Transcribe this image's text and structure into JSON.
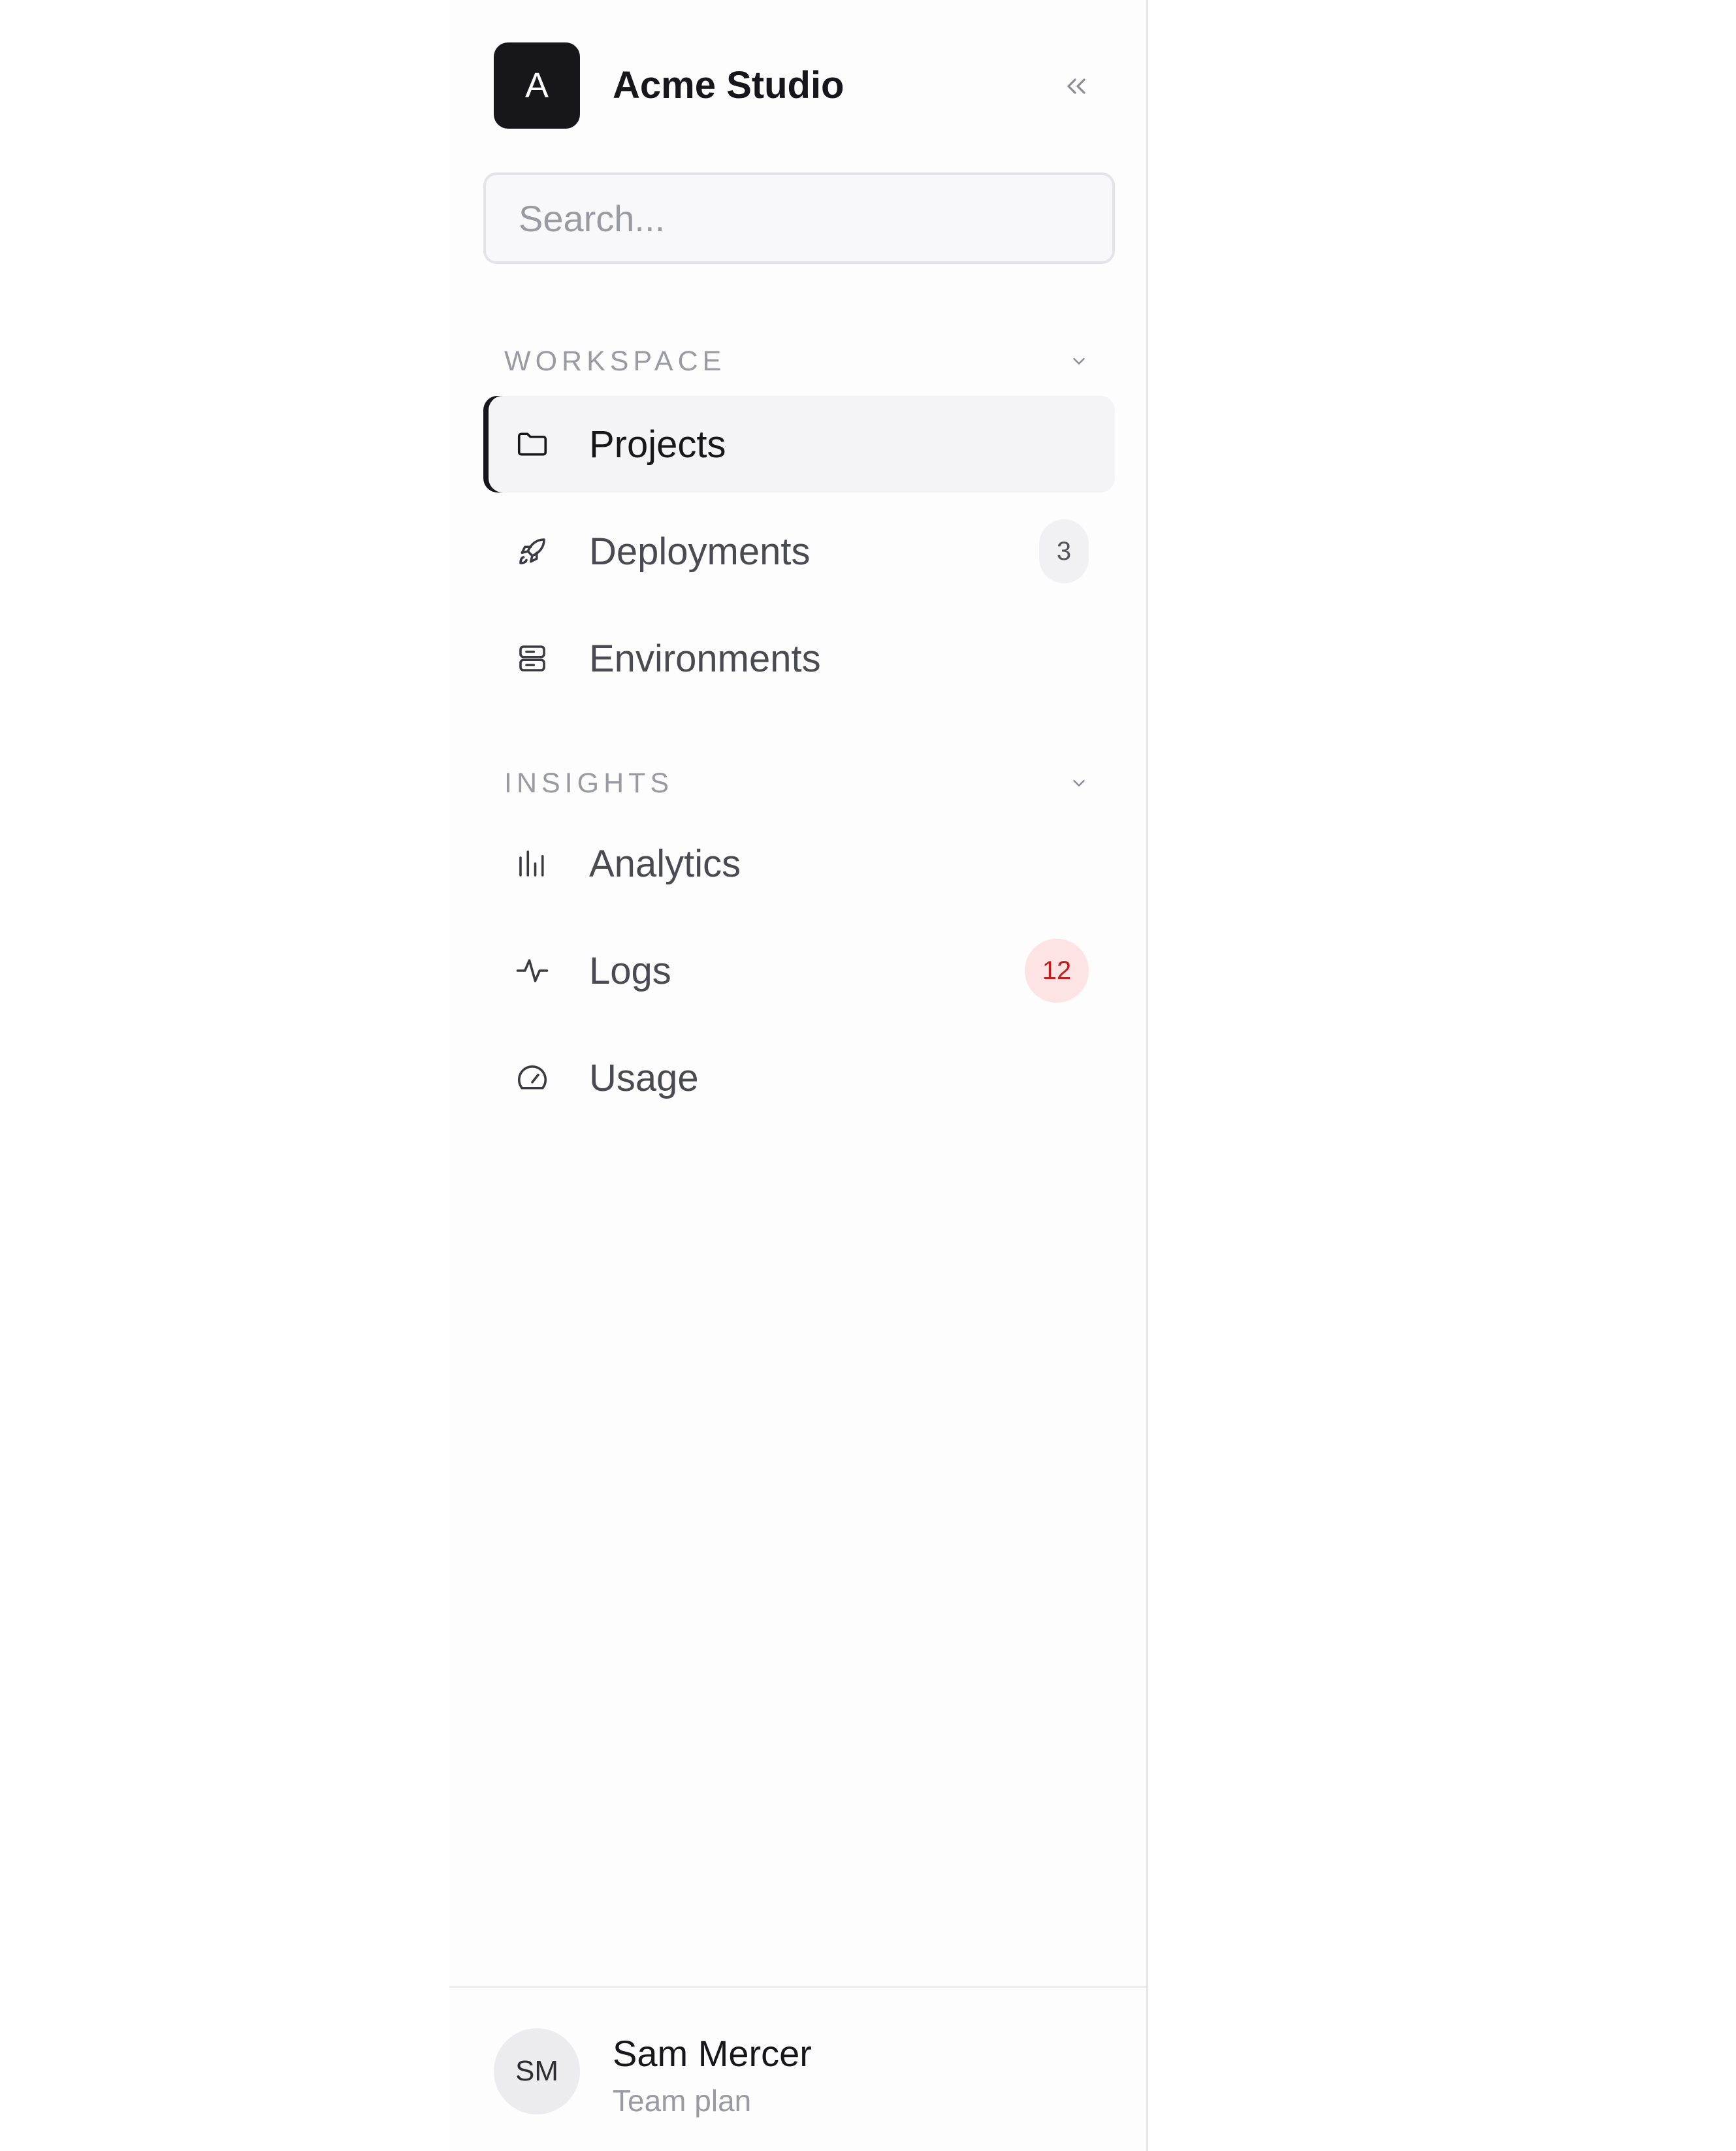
{
  "brand": {
    "logo_letter": "A",
    "name": "Acme Studio"
  },
  "collapse_icon": "chevrons-left-icon",
  "search": {
    "placeholder": "Search...",
    "value": ""
  },
  "sections": [
    {
      "title": "WORKSPACE",
      "items": [
        {
          "label": "Projects",
          "icon": "folder-icon",
          "active": true,
          "badge": null
        },
        {
          "label": "Deployments",
          "icon": "rocket-icon",
          "active": false,
          "badge": "3"
        },
        {
          "label": "Environments",
          "icon": "server-icon",
          "active": false,
          "badge": null
        }
      ]
    },
    {
      "title": "INSIGHTS",
      "items": [
        {
          "label": "Analytics",
          "icon": "bar-chart-icon",
          "active": false,
          "badge": null
        },
        {
          "label": "Logs",
          "icon": "activity-icon",
          "active": false,
          "badge": "12"
        },
        {
          "label": "Usage",
          "icon": "gauge-icon",
          "active": false,
          "badge": null
        }
      ]
    }
  ],
  "user": {
    "initials": "SM",
    "name": "Sam Mercer",
    "plan": "Team plan"
  },
  "colors": {
    "accent": "#17171b",
    "alert_badge_bg": "#fde3e3",
    "alert_badge_text": "#c11d1d",
    "muted_text": "#9a9aa3"
  }
}
